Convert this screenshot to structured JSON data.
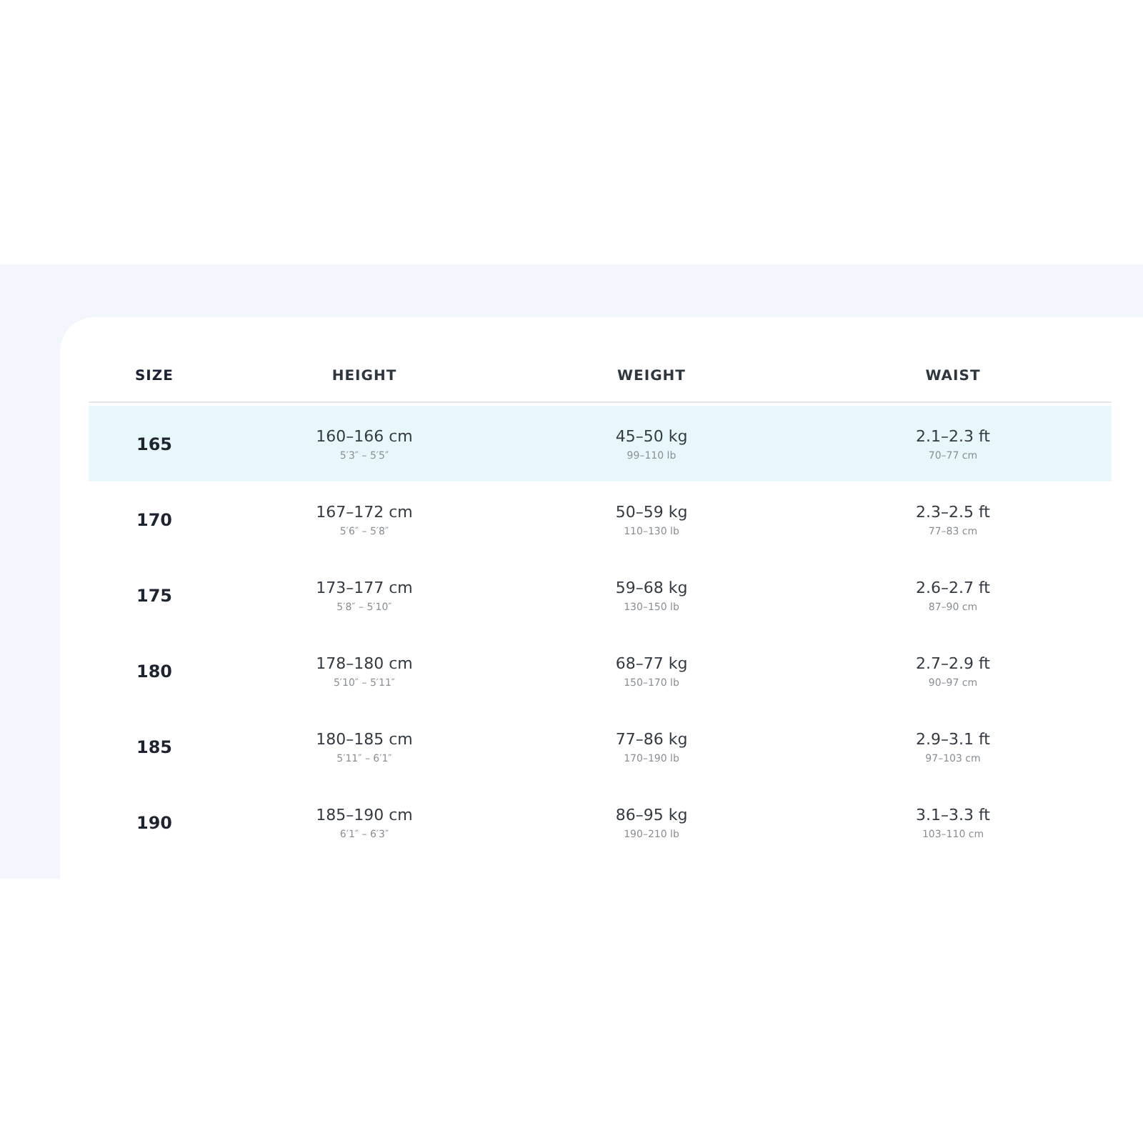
{
  "table": {
    "columns": [
      "SIZE",
      "HEIGHT",
      "WEIGHT",
      "WAIST"
    ],
    "rows": [
      {
        "size": "165",
        "height": "160–166 cm",
        "height_alt": "5′3″ – 5′5″",
        "weight": "45–50 kg",
        "weight_alt": "99–110 lb",
        "waist": "2.1–2.3 ft",
        "waist_alt": "70–77 cm",
        "highlighted": true
      },
      {
        "size": "170",
        "height": "167–172 cm",
        "height_alt": "5′6″ – 5′8″",
        "weight": "50–59 kg",
        "weight_alt": "110–130 lb",
        "waist": "2.3–2.5 ft",
        "waist_alt": "77–83 cm",
        "highlighted": false
      },
      {
        "size": "175",
        "height": "173–177 cm",
        "height_alt": "5′8″ – 5′10″",
        "weight": "59–68 kg",
        "weight_alt": "130–150 lb",
        "waist": "2.6–2.7 ft",
        "waist_alt": "87–90 cm",
        "highlighted": false
      },
      {
        "size": "180",
        "height": "178–180 cm",
        "height_alt": "5′10″ – 5′11″",
        "weight": "68–77 kg",
        "weight_alt": "150–170 lb",
        "waist": "2.7–2.9 ft",
        "waist_alt": "90–97 cm",
        "highlighted": false
      },
      {
        "size": "185",
        "height": "180–185 cm",
        "height_alt": "5′11″ – 6′1″",
        "weight": "77–86 kg",
        "weight_alt": "170–190 lb",
        "waist": "2.9–3.1 ft",
        "waist_alt": "97–103 cm",
        "highlighted": false
      },
      {
        "size": "190",
        "height": "185–190 cm",
        "height_alt": "6′1″ – 6′3″",
        "weight": "86–95 kg",
        "weight_alt": "190–210 lb",
        "waist": "3.1–3.3 ft",
        "waist_alt": "103–110 cm",
        "highlighted": false
      }
    ]
  }
}
